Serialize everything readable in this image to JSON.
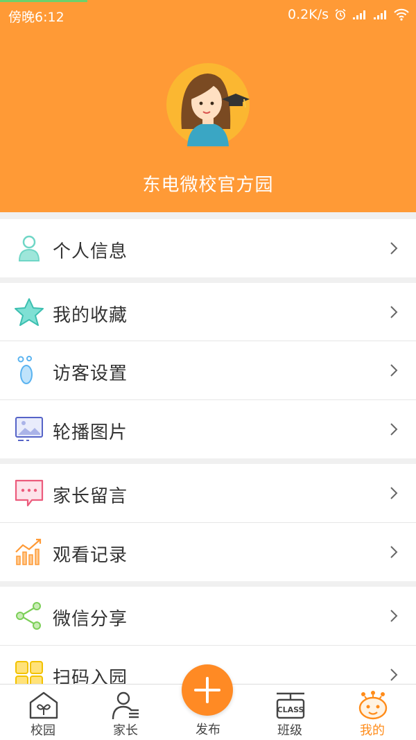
{
  "status_bar": {
    "time": "傍晚6:12",
    "net_speed": "0.2K/s"
  },
  "profile": {
    "name": "东电微校官方园"
  },
  "menu": [
    {
      "label": "个人信息",
      "icon": "person-icon"
    },
    {
      "label": "我的收藏",
      "icon": "star-icon"
    },
    {
      "label": "访客设置",
      "icon": "visitor-icon"
    },
    {
      "label": "轮播图片",
      "icon": "image-icon"
    },
    {
      "label": "家长留言",
      "icon": "message-icon"
    },
    {
      "label": "观看记录",
      "icon": "chart-icon"
    },
    {
      "label": "微信分享",
      "icon": "share-icon"
    },
    {
      "label": "扫码入园",
      "icon": "qr-icon"
    }
  ],
  "tabs": [
    {
      "label": "校园",
      "icon": "campus-icon"
    },
    {
      "label": "家长",
      "icon": "parent-icon"
    },
    {
      "label": "发布",
      "icon": "plus-icon"
    },
    {
      "label": "班级",
      "icon": "class-icon"
    },
    {
      "label": "我的",
      "icon": "mine-icon"
    }
  ],
  "tab_class_text": "CLASS",
  "colors": {
    "header": "#ff9a36",
    "accent": "#ff8c1a"
  }
}
